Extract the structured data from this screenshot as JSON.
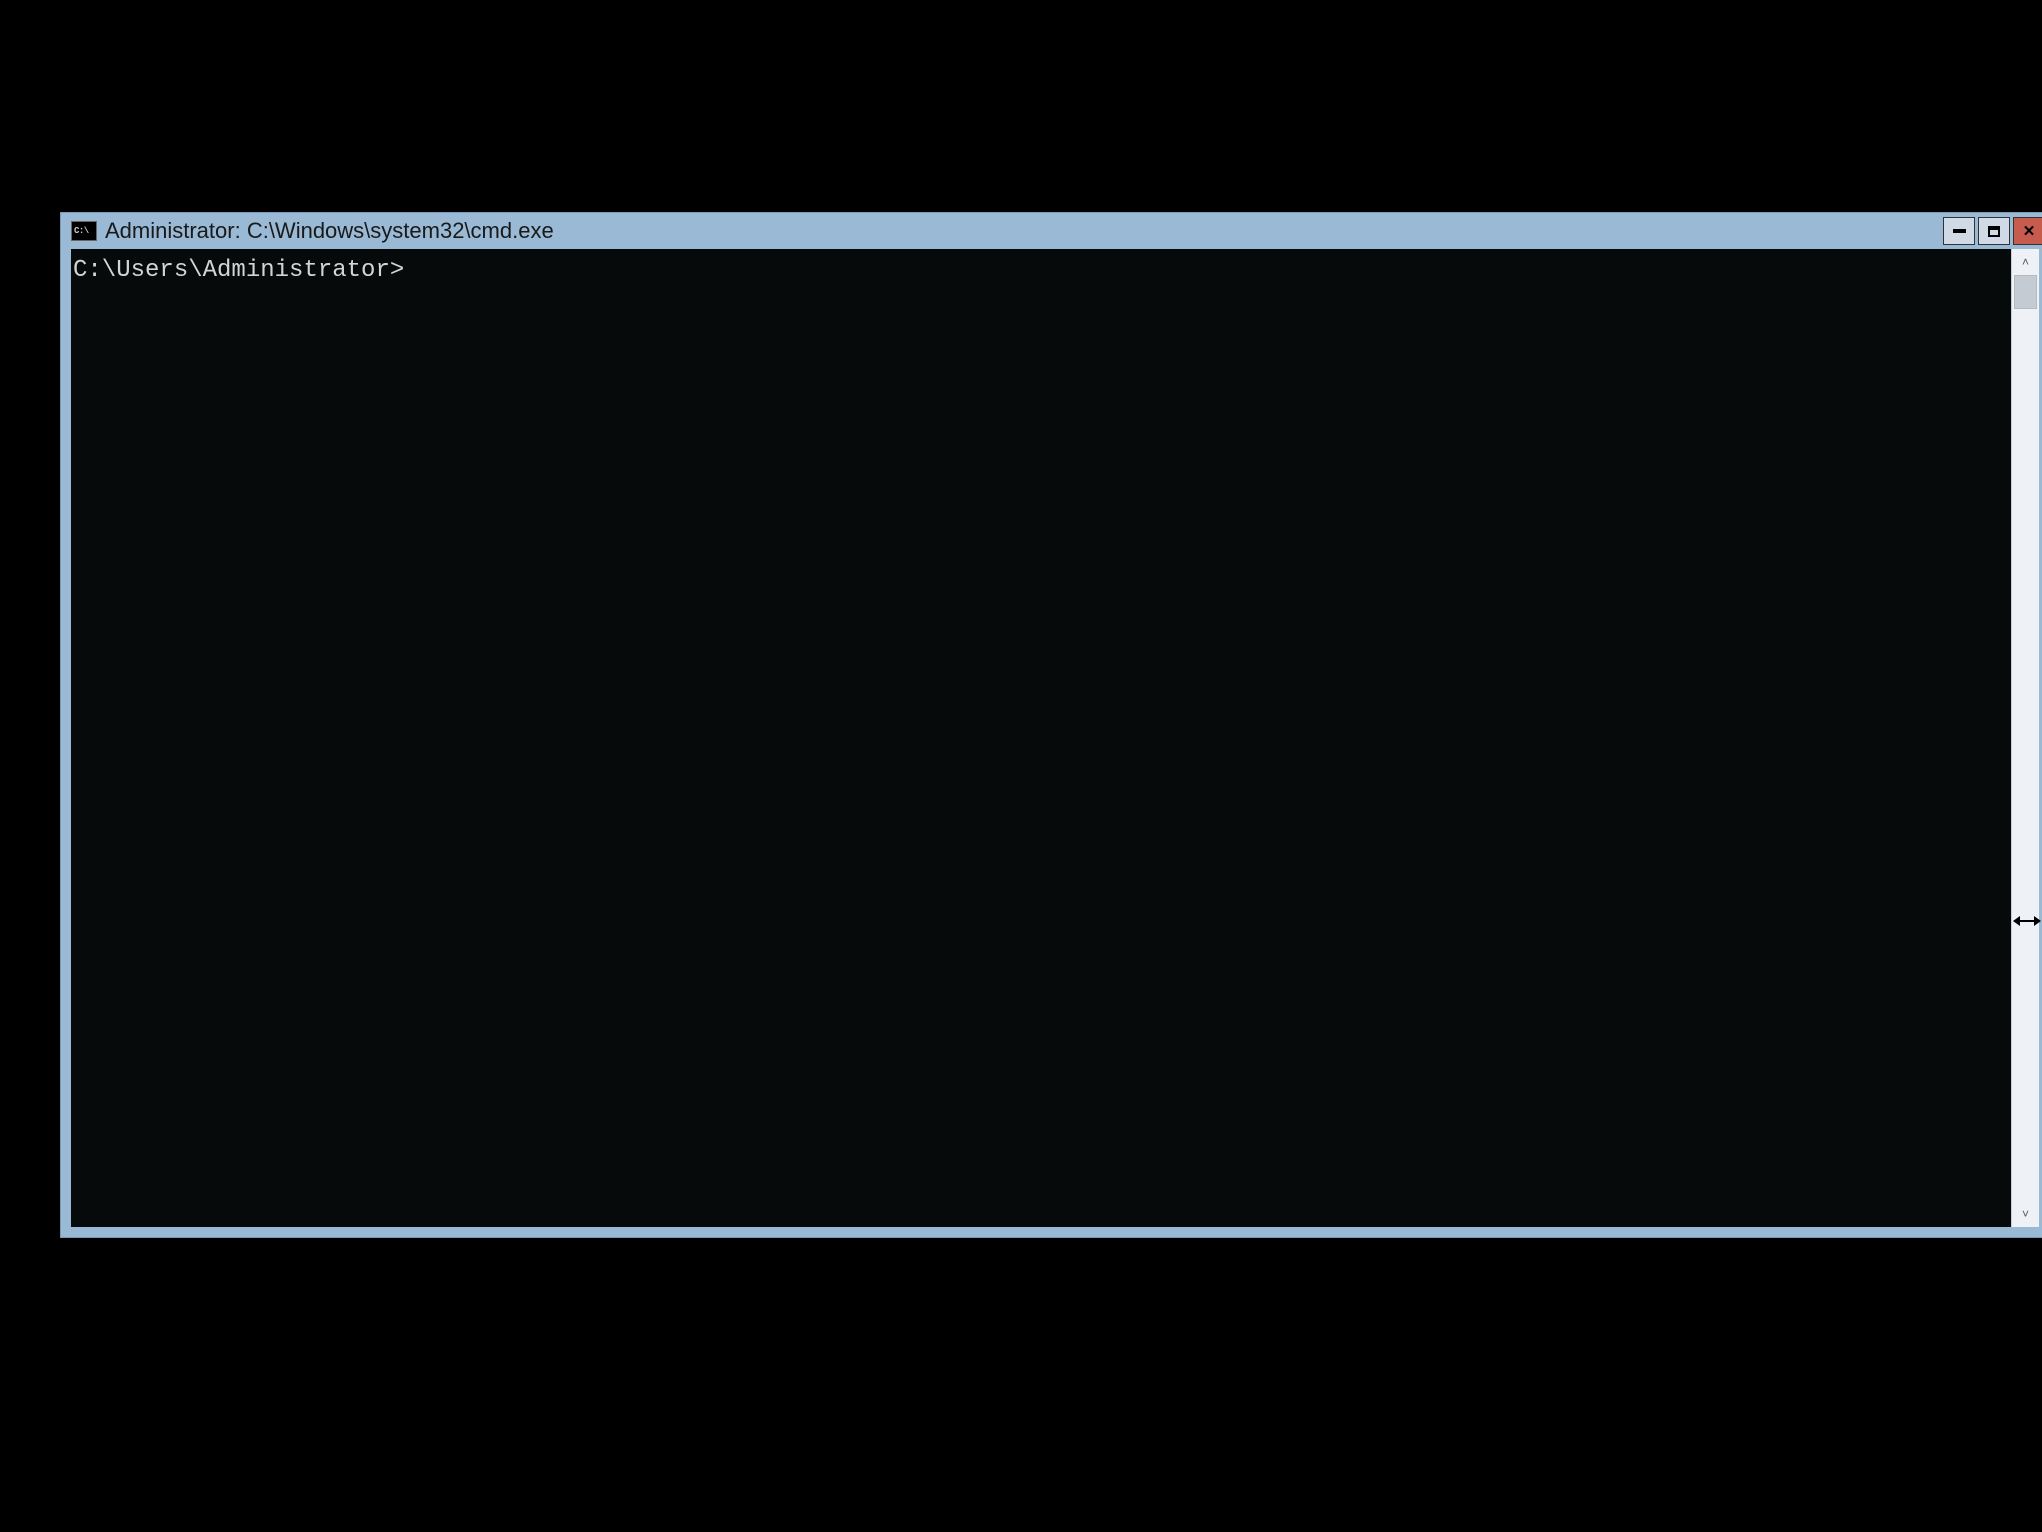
{
  "window": {
    "title": "Administrator: C:\\Windows\\system32\\cmd.exe",
    "icon_label": "C:\\"
  },
  "controls": {
    "minimize": "Minimize",
    "maximize": "Maximize",
    "close": "Close"
  },
  "terminal": {
    "prompt": "C:\\Users\\Administrator>"
  },
  "scrollbar": {
    "up": "˄",
    "down": "˅"
  }
}
